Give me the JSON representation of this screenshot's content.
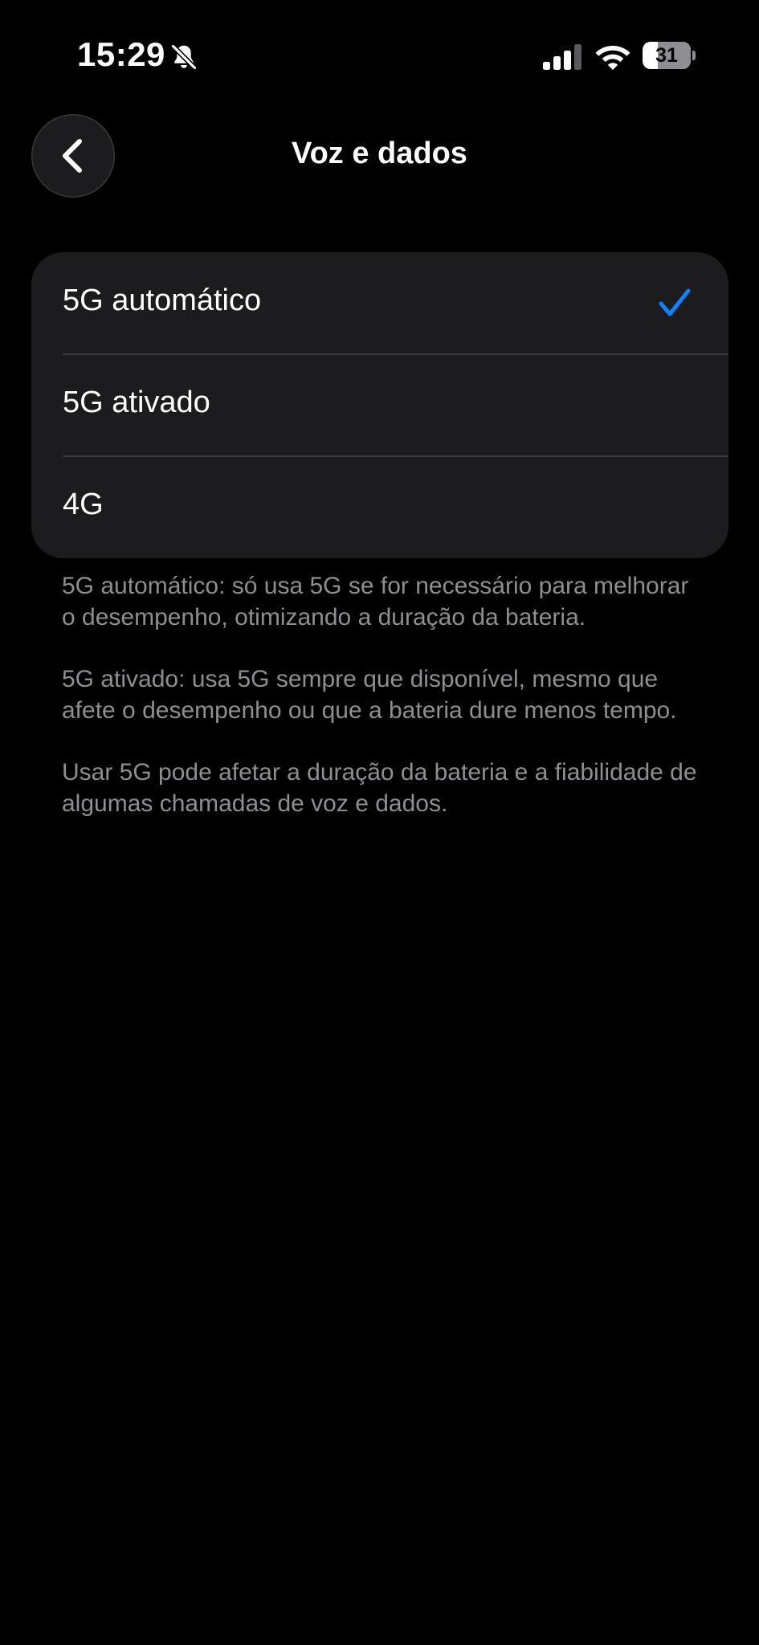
{
  "status_bar": {
    "time": "15:29",
    "silent_icon": "bell-slash-icon",
    "signal_icon": "cellular-signal-icon",
    "wifi_icon": "wifi-icon",
    "battery_level": "31",
    "battery_fraction": 0.31
  },
  "nav": {
    "back_icon": "chevron-left-icon",
    "title": "Voz e dados"
  },
  "options": [
    {
      "label": "5G automático",
      "selected": true
    },
    {
      "label": "5G ativado",
      "selected": false
    },
    {
      "label": "4G",
      "selected": false
    }
  ],
  "footer": {
    "notes": [
      "5G automático: só usa 5G se for necessário para melhorar o desempenho, otimizando a duração da bateria.",
      "5G ativado: usa 5G sempre que disponível, mesmo que afete o desempenho ou que a bateria dure menos tempo.",
      "Usar 5G pode afetar a duração da bateria e a fiabilidade de algumas chamadas de voz e dados."
    ]
  },
  "colors": {
    "background": "#000000",
    "group_background": "#1c1c1e",
    "accent_checkmark": "#0a84ff",
    "secondary_text": "#8e8e93",
    "separator": "#3a3a3c"
  }
}
